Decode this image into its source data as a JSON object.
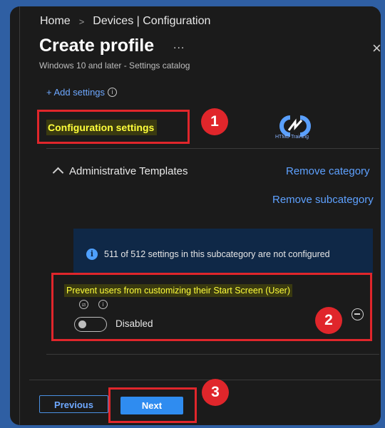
{
  "breadcrumb": {
    "home": "Home",
    "separator": ">",
    "current": "Devices | Configuration"
  },
  "header": {
    "title": "Create profile",
    "more": "...",
    "close": "×",
    "subtitle": "Windows 10 and later - Settings catalog"
  },
  "add_settings": {
    "label": "+ Add settings",
    "info": "i"
  },
  "section": {
    "title": "Configuration settings"
  },
  "logo": {
    "text": "HTMD Training"
  },
  "category": {
    "name": "Administrative Templates",
    "remove_category": "Remove category",
    "remove_subcategory": "Remove subcategory"
  },
  "info_banner": {
    "icon": "i",
    "text": "511 of 512 settings in this subcategory are not configured"
  },
  "setting": {
    "name": "Prevent users from customizing their Start Screen (User)",
    "toggle_state": "Disabled",
    "enabled": false
  },
  "callouts": [
    "1",
    "2",
    "3"
  ],
  "footer": {
    "previous": "Previous",
    "next": "Next"
  },
  "colors": {
    "accent": "#2f8cf0",
    "highlight": "#e0262b",
    "link": "#5ea1ff",
    "label_yellow": "#ffff3b"
  }
}
